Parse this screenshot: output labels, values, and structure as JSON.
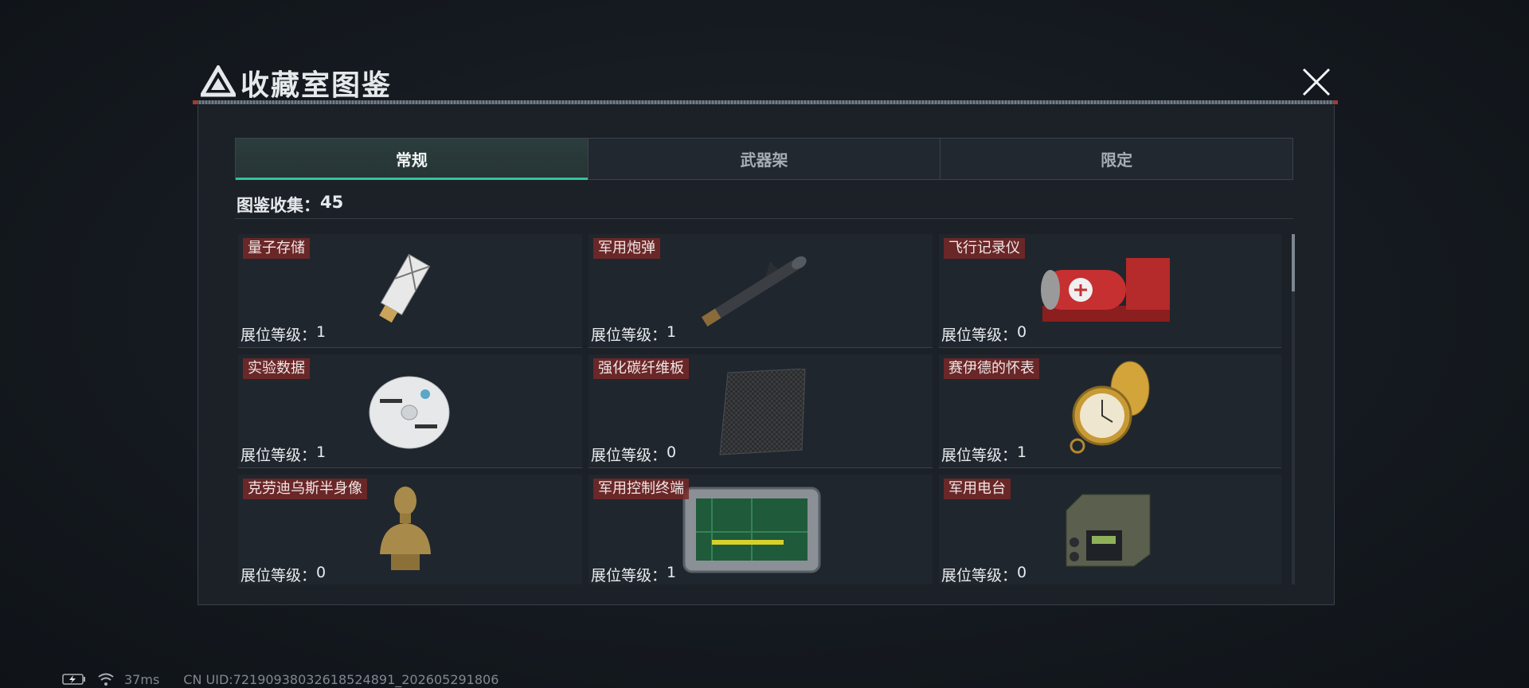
{
  "header": {
    "title": "收藏室图鉴",
    "logo_icon": "triangle-logo-icon",
    "close_icon": "close-icon"
  },
  "tabs": [
    {
      "label": "常规",
      "active": true
    },
    {
      "label": "武器架",
      "active": false
    },
    {
      "label": "限定",
      "active": false
    }
  ],
  "collection": {
    "label": "图鉴收集：",
    "count": "45"
  },
  "level_label": "展位等级：",
  "items": [
    {
      "name": "量子存储",
      "level": "1",
      "icon": "usb-drive-icon"
    },
    {
      "name": "军用炮弹",
      "level": "1",
      "icon": "missile-icon"
    },
    {
      "name": "飞行记录仪",
      "level": "0",
      "icon": "flight-recorder-icon"
    },
    {
      "name": "实验数据",
      "level": "1",
      "icon": "disc-icon"
    },
    {
      "name": "强化碳纤维板",
      "level": "0",
      "icon": "carbon-plate-icon"
    },
    {
      "name": "赛伊德的怀表",
      "level": "1",
      "icon": "pocket-watch-icon"
    },
    {
      "name": "克劳迪乌斯半身像",
      "level": "0",
      "icon": "bust-icon"
    },
    {
      "name": "军用控制终端",
      "level": "1",
      "icon": "control-terminal-icon"
    },
    {
      "name": "军用电台",
      "level": "0",
      "icon": "radio-icon"
    }
  ],
  "status": {
    "ping": "37ms",
    "uid": "CN UID:72190938032618524891_202605291806",
    "battery_icon": "battery-icon",
    "wifi_icon": "wifi-icon"
  },
  "colors": {
    "accent": "#35c39a",
    "name_tag": "#7a2828",
    "panel": "#1c2128"
  }
}
